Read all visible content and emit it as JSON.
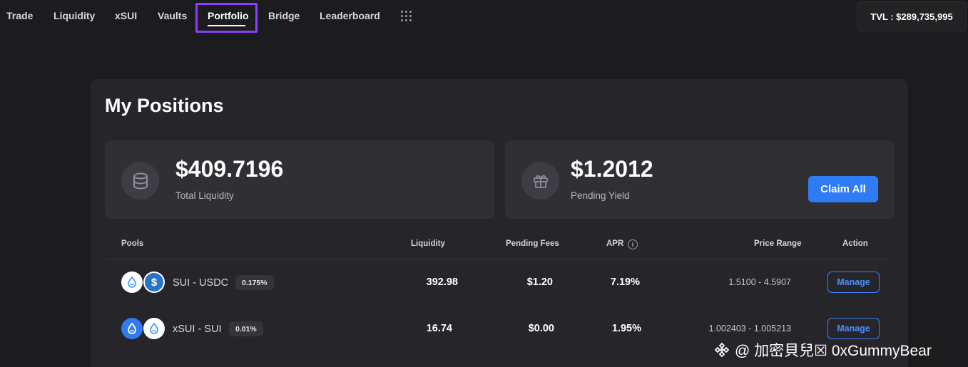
{
  "nav": {
    "items": [
      {
        "label": "Trade"
      },
      {
        "label": "Liquidity"
      },
      {
        "label": "xSUI"
      },
      {
        "label": "Vaults"
      },
      {
        "label": "Portfolio",
        "active": true
      },
      {
        "label": "Bridge"
      },
      {
        "label": "Leaderboard"
      }
    ],
    "apps_icon": "grid-dots-icon",
    "tvl": "TVL : $289,735,995"
  },
  "page": {
    "title": "My Positions"
  },
  "stats": {
    "total_liquidity": {
      "value": "$409.7196",
      "label": "Total Liquidity",
      "icon": "database-stack-icon"
    },
    "pending_yield": {
      "value": "$1.2012",
      "label": "Pending Yield",
      "icon": "gift-icon"
    },
    "claim_label": "Claim All"
  },
  "table": {
    "headers": {
      "pools": "Pools",
      "liquidity": "Liquidity",
      "pending_fees": "Pending Fees",
      "apr": "APR",
      "price_range": "Price Range",
      "action": "Action"
    },
    "apr_info_icon": "info-icon",
    "rows": [
      {
        "pair": "SUI - USDC",
        "fee_tier": "0.175%",
        "tokens": [
          "sui-token-icon",
          "usdc-token-icon"
        ],
        "liquidity": "392.98",
        "pending_fees": "$1.20",
        "apr": "7.19%",
        "price_range": "1.5100 - 4.5907",
        "action": "Manage"
      },
      {
        "pair": "xSUI - SUI",
        "fee_tier": "0.01%",
        "tokens": [
          "xsui-token-icon",
          "sui-token-icon"
        ],
        "liquidity": "16.74",
        "pending_fees": "$0.00",
        "apr": "1.95%",
        "price_range": "1.002403 - 1.005213",
        "action": "Manage"
      }
    ]
  },
  "colors": {
    "background": "#1c1c1f",
    "card": "#26262a",
    "accent": "#2f7bf6",
    "active_nav_outline": "#8a3ffc"
  },
  "watermark": {
    "text": "@ 加密貝兒☒ 0xGummyBear"
  }
}
